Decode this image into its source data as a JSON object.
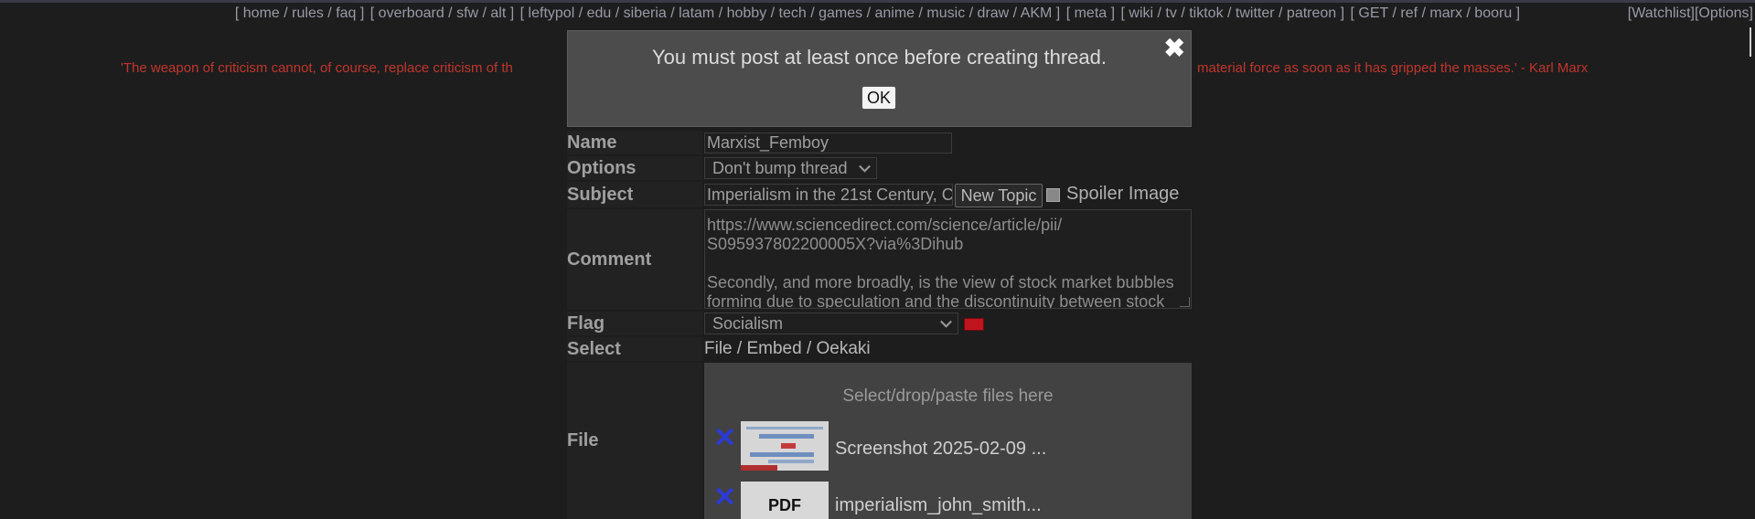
{
  "nav": {
    "groups": [
      [
        "home",
        "rules",
        "faq"
      ],
      [
        "overboard",
        "sfw",
        "alt"
      ],
      [
        "leftypol",
        "edu",
        "siberia",
        "latam",
        "hobby",
        "tech",
        "games",
        "anime",
        "music",
        "draw",
        "AKM"
      ],
      [
        "meta"
      ],
      [
        "wiki",
        "tv",
        "tiktok",
        "twitter",
        "patreon"
      ],
      [
        "GET",
        "ref",
        "marx",
        "booru"
      ]
    ],
    "watchlist": "[Watchlist]",
    "options": "[Options]"
  },
  "quote_left": "'The weapon of criticism cannot, of course, replace criticism of th",
  "quote_right": "material force as soon as it has gripped the masses.' - Karl Marx",
  "modal": {
    "message": "You must post at least once before creating thread.",
    "ok": "OK",
    "close": "✖"
  },
  "form": {
    "name_label": "Name",
    "name_value": "Marxist_Femboy",
    "options_label": "Options",
    "options_value": "Don't bump thread",
    "subject_label": "Subject",
    "subject_value": "Imperialism in the 21st Century, C",
    "new_topic": "New Topic",
    "spoiler_label": "Spoiler Image",
    "comment_label": "Comment",
    "comment_lines": [
      "https://www.sciencedirect.com/science/article/pii/",
      "S095937802200005X?via%3Dihub",
      "",
      "Secondly, and more broadly, is the view of stock market bubbles",
      "forming due to speculation and the discontinuity between stock"
    ],
    "flag_label": "Flag",
    "flag_value": "Socialism",
    "select_label": "Select",
    "select_file": "File",
    "select_embed": "Embed",
    "select_oekaki": "Oekaki",
    "file_label": "File",
    "drop_message": "Select/drop/paste files here",
    "files": [
      {
        "name": "Screenshot 2025-02-09 ...",
        "remove": "✕"
      },
      {
        "name": "imperialism_john_smith...",
        "remove": "✕",
        "thumb_text": "PDF"
      }
    ]
  },
  "colors": {
    "quote": "#c0362c",
    "remove_x": "#2c3ad6",
    "flag_red": "#c0141e"
  }
}
